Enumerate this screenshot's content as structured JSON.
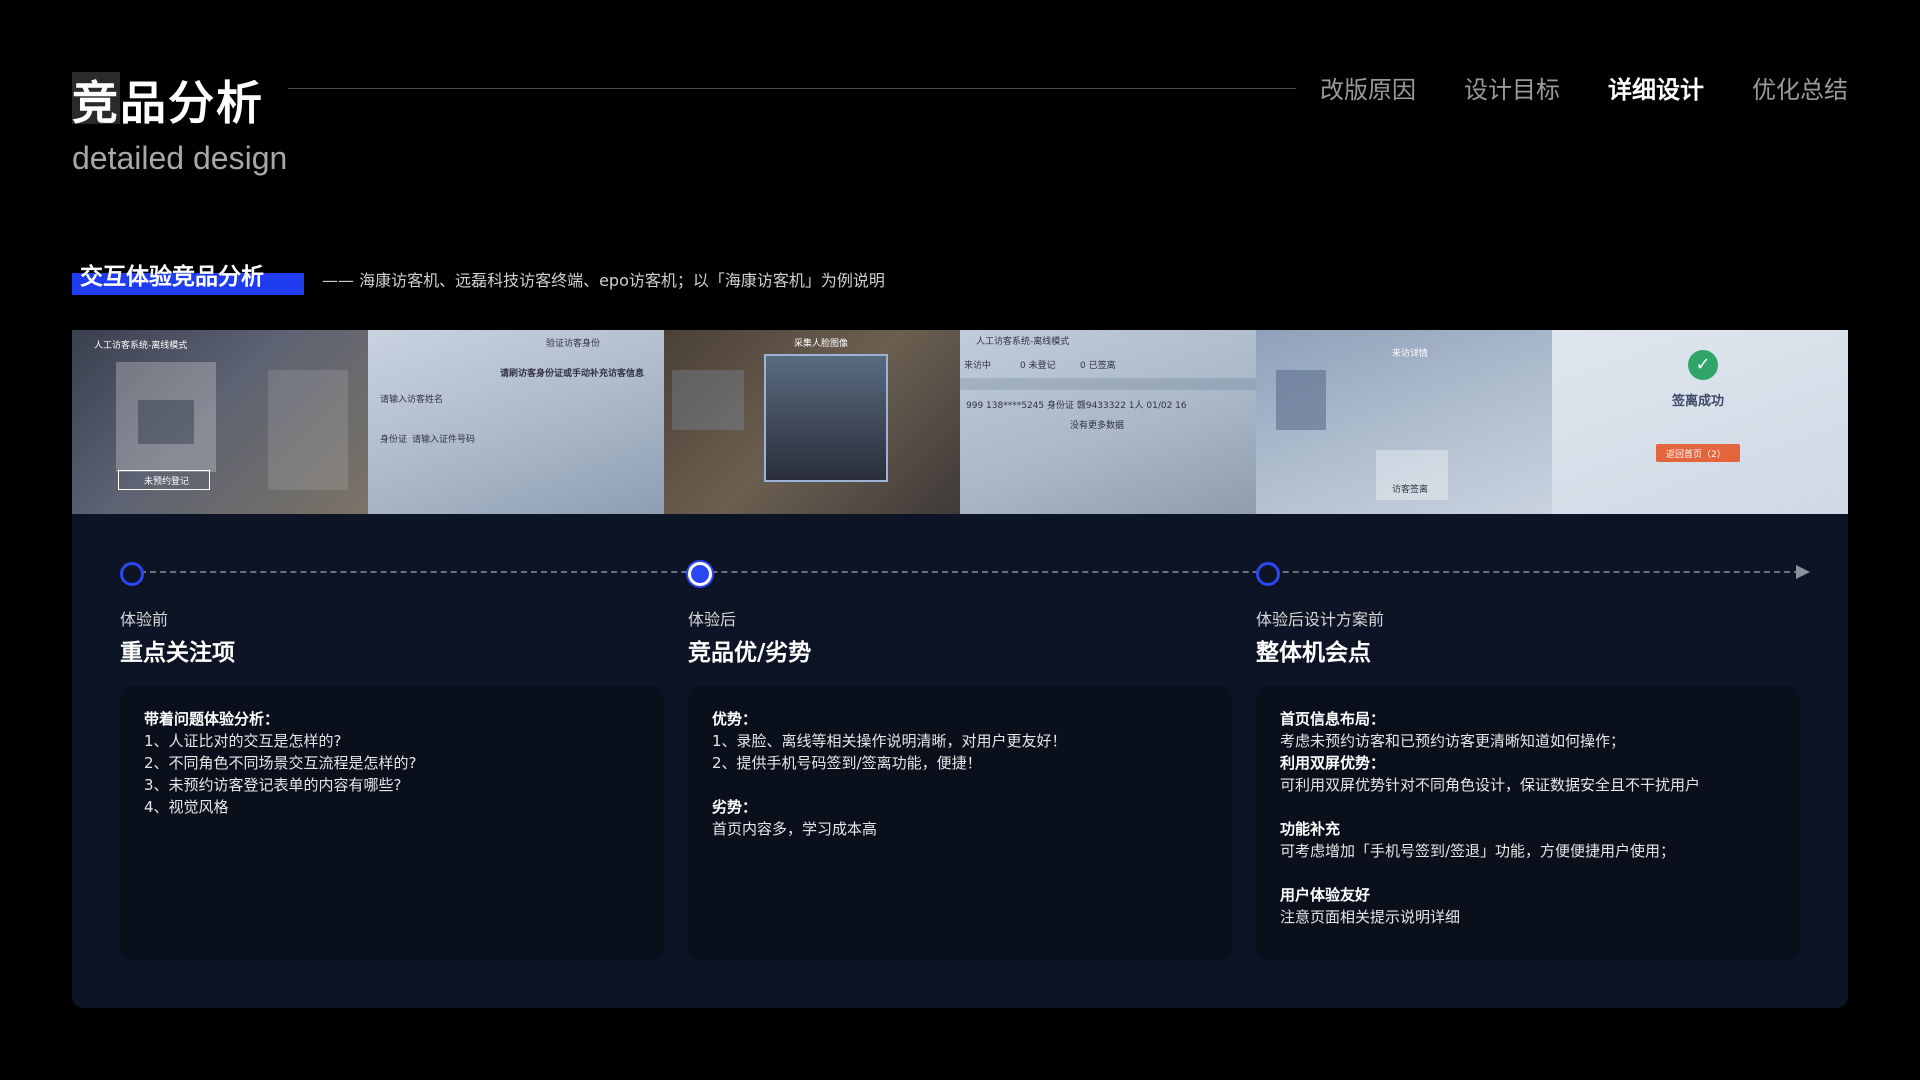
{
  "header": {
    "title": "竞品分析",
    "subtitle": "detailed design",
    "nav": [
      "改版原因",
      "设计目标",
      "详细设计",
      "优化总结"
    ],
    "active_nav": "详细设计"
  },
  "section": {
    "label": "交互体验竞品分析",
    "description": "—— 海康访客机、远磊科技访客终端、epo访客机；以「海康访客机」为例说明"
  },
  "screenshots": {
    "s1_header": "人工访客系统-离线模式",
    "s1_button": "未预约登记",
    "s2_header": "验证访客身份",
    "s2_title": "请刷访客身份证或手动补充访客信息",
    "s2_field1": "请输入访客姓名",
    "s2_field2": "身份证",
    "s2_field3": "请输入证件号码",
    "s3_header": "采集人脸图像",
    "s4_header": "人工访客系统-离线模式",
    "s4_tab1": "来访中",
    "s4_tab2": "0 未登记",
    "s4_tab3": "0 已签离",
    "s4_row": "999   138****5245   身份证 赣9433322   1人   01/02 16",
    "s4_empty": "没有更多数据",
    "s5_header": "来访详情",
    "s5_label": "访客签离",
    "s6_title": "签离成功",
    "s6_button": "返回首页（2）"
  },
  "columns": [
    {
      "kicker": "体验前",
      "title": "重点关注项",
      "lines": [
        {
          "text": "带着问题体验分析：",
          "bold": true
        },
        {
          "text": "1、人证比对的交互是怎样的?",
          "bold": false
        },
        {
          "text": "2、不同角色不同场景交互流程是怎样的?",
          "bold": false
        },
        {
          "text": "3、未预约访客登记表单的内容有哪些?",
          "bold": false
        },
        {
          "text": "4、视觉风格",
          "bold": false
        }
      ]
    },
    {
      "kicker": "体验后",
      "title": "竞品优/劣势",
      "lines": [
        {
          "text": "优势：",
          "bold": true
        },
        {
          "text": "1、录脸、离线等相关操作说明清晰，对用户更友好！",
          "bold": false
        },
        {
          "text": "2、提供手机号码签到/签离功能，便捷！",
          "bold": false
        },
        {
          "text": "劣势：",
          "bold": true
        },
        {
          "text": "首页内容多，学习成本高",
          "bold": false
        }
      ]
    },
    {
      "kicker": "体验后设计方案前",
      "title": "整体机会点",
      "lines": [
        {
          "text": "首页信息布局：",
          "bold": true
        },
        {
          "text": "考虑未预约访客和已预约访客更清晰知道如何操作；",
          "bold": false
        },
        {
          "text": "利用双屏优势：",
          "bold": true
        },
        {
          "text": "可利用双屏优势针对不同角色设计，保证数据安全且不干扰用户",
          "bold": false
        },
        {
          "text": "功能补充",
          "bold": true
        },
        {
          "text": "可考虑增加「手机号签到/签退」功能，方便便捷用户使用；",
          "bold": false
        },
        {
          "text": "用户体验友好",
          "bold": true
        },
        {
          "text": "注意页面相关提示说明详细",
          "bold": false
        }
      ]
    }
  ],
  "colors": {
    "accent_blue": "#1f3cf0",
    "panel_bg": "#0d1425",
    "card_bg": "#0a0f1c"
  }
}
